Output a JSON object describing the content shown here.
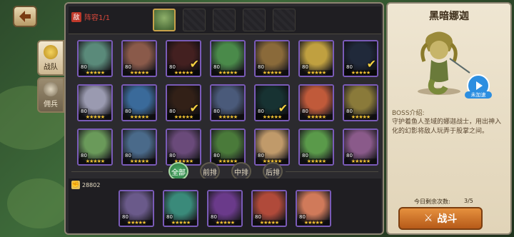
{
  "header": {
    "formation_label": "阵容1/1",
    "formation_badge": "敌"
  },
  "side_tabs": [
    {
      "label": "战队",
      "active": true
    },
    {
      "label": "佣兵",
      "active": false
    }
  ],
  "team_slots": [
    "filled",
    "empty",
    "empty",
    "empty",
    "empty"
  ],
  "heroes": [
    {
      "level": "80",
      "stars": "★★★★★",
      "hue": "#5a8a7a",
      "checked": false,
      "dim": false
    },
    {
      "level": "80",
      "stars": "★★★★★",
      "hue": "#8a5a4a",
      "checked": false,
      "dim": false
    },
    {
      "level": "80",
      "stars": "★★★★★",
      "hue": "#7a3a3a",
      "checked": true,
      "dim": true
    },
    {
      "level": "80",
      "stars": "★★★★★",
      "hue": "#4a8a4a",
      "checked": false,
      "dim": false
    },
    {
      "level": "80",
      "stars": "★★★★★",
      "hue": "#8a6a3a",
      "checked": false,
      "dim": false
    },
    {
      "level": "80",
      "stars": "★★★★★",
      "hue": "#c0a040",
      "checked": false,
      "dim": false
    },
    {
      "level": "80",
      "stars": "★★★★★",
      "hue": "#3a4a6a",
      "checked": true,
      "dim": true
    },
    {
      "level": "80",
      "stars": "★★★★★",
      "hue": "#9a9ab0",
      "checked": false,
      "dim": false
    },
    {
      "level": "80",
      "stars": "★★★★★",
      "hue": "#3a6a9a",
      "checked": false,
      "dim": false
    },
    {
      "level": "80",
      "stars": "★★★★★",
      "hue": "#5a3a2a",
      "checked": true,
      "dim": true
    },
    {
      "level": "80",
      "stars": "★★★★★",
      "hue": "#4a5a7a",
      "checked": false,
      "dim": false
    },
    {
      "level": "80",
      "stars": "★★★★★",
      "hue": "#2a5a5a",
      "checked": true,
      "dim": true
    },
    {
      "level": "80",
      "stars": "★★★★★",
      "hue": "#c05a3a",
      "checked": false,
      "dim": false
    },
    {
      "level": "80",
      "stars": "★★★★★",
      "hue": "#8a7a3a",
      "checked": false,
      "dim": false
    },
    {
      "level": "80",
      "stars": "★★★★★",
      "hue": "#6a9a5a",
      "checked": false,
      "dim": false
    },
    {
      "level": "80",
      "stars": "★★★★★",
      "hue": "#4a6a8a",
      "checked": false,
      "dim": false
    },
    {
      "level": "80",
      "stars": "★★★★★",
      "hue": "#6a4a7a",
      "checked": false,
      "dim": false
    },
    {
      "level": "80",
      "stars": "★★★★★",
      "hue": "#4a7a3a",
      "checked": false,
      "dim": false
    },
    {
      "level": "80",
      "stars": "★★★★★",
      "hue": "#c09a6a",
      "checked": false,
      "dim": false
    },
    {
      "level": "80",
      "stars": "★★★★★",
      "hue": "#5a9a4a",
      "checked": false,
      "dim": false
    },
    {
      "level": "80",
      "stars": "★★★★★",
      "hue": "#8a5a8a",
      "checked": false,
      "dim": false
    }
  ],
  "filters": [
    {
      "label": "全部",
      "active": true
    },
    {
      "label": "前排",
      "active": false
    },
    {
      "label": "中排",
      "active": false
    },
    {
      "label": "后排",
      "active": false
    }
  ],
  "power": {
    "value": "28802"
  },
  "team": [
    {
      "level": "80",
      "stars": "★★★★★",
      "hue": "#6a5a8a"
    },
    {
      "level": "80",
      "stars": "★★★★★",
      "hue": "#3a8a7a"
    },
    {
      "level": "80",
      "stars": "★★★★★",
      "hue": "#6a3a8a"
    },
    {
      "level": "80",
      "stars": "★★★★★",
      "hue": "#b04a3a"
    },
    {
      "level": "80",
      "stars": "★★★★★",
      "hue": "#d07a5a"
    }
  ],
  "boss": {
    "name": "黑暗娜迦",
    "play_label": "未加速",
    "intro_title": "BOSS介绍:",
    "intro": "守护着鱼人圣域的娜迦战士，用出神入化的幻影将敌人玩弄于股掌之间。"
  },
  "attempts": {
    "label": "今日剩余次数:",
    "value": "3/5"
  },
  "fight": {
    "label": "战斗"
  }
}
